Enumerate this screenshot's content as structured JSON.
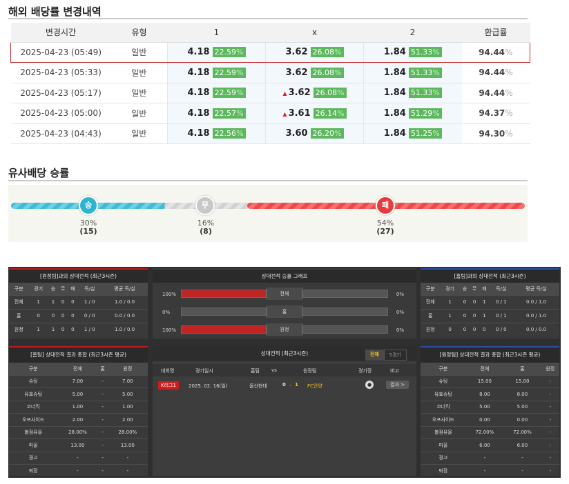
{
  "odds_history": {
    "title": "해외 배당률 변경내역",
    "headers": [
      "변경시간",
      "유형",
      "1",
      "x",
      "2",
      "환급률"
    ],
    "rows": [
      {
        "time": "2025-04-23 (05:49)",
        "type": "일반",
        "o1": "4.18",
        "p1": "22.59",
        "ox": "3.62",
        "px": "26.08",
        "ox_arrow": "",
        "o2": "1.84",
        "p2": "51.33",
        "refund": "94.44"
      },
      {
        "time": "2025-04-23 (05:33)",
        "type": "일반",
        "o1": "4.18",
        "p1": "22.59",
        "ox": "3.62",
        "px": "26.08",
        "ox_arrow": "",
        "o2": "1.84",
        "p2": "51.33",
        "refund": "94.44"
      },
      {
        "time": "2025-04-23 (05:17)",
        "type": "일반",
        "o1": "4.18",
        "p1": "22.59",
        "ox": "3.62",
        "px": "26.08",
        "ox_arrow": "▲",
        "o2": "1.84",
        "p2": "51.33",
        "refund": "94.44"
      },
      {
        "time": "2025-04-23 (05:00)",
        "type": "일반",
        "o1": "4.18",
        "p1": "22.57",
        "ox": "3.61",
        "px": "26.14",
        "ox_arrow": "▲",
        "o2": "1.84",
        "p2": "51.29",
        "refund": "94.37"
      },
      {
        "time": "2025-04-23 (04:43)",
        "type": "일반",
        "o1": "4.18",
        "p1": "22.56",
        "ox": "3.60",
        "px": "26.20",
        "ox_arrow": "",
        "o2": "1.84",
        "p2": "51.25",
        "refund": "94.30"
      }
    ],
    "unit": "%"
  },
  "similar_odds": {
    "title": "유사배당 승률",
    "win": {
      "label": "승",
      "pct": "30%",
      "count": "(15)",
      "value": 30,
      "color": "#3fbcd6"
    },
    "draw": {
      "label": "무",
      "pct": "16%",
      "count": "(8)",
      "value": 16,
      "color": "#cfcfcf"
    },
    "lose": {
      "label": "패",
      "pct": "54%",
      "count": "(27)",
      "value": 54,
      "color": "#f05050"
    }
  },
  "away_record": {
    "title": "[원정팀]과의 상대전적 (최근3시즌)",
    "headers": [
      "구분",
      "경기",
      "승",
      "무",
      "패",
      "득/실",
      "평균 득/실"
    ],
    "rows": [
      [
        "전체",
        "1",
        "1",
        "0",
        "0",
        "1 / 0",
        "1.0 / 0.0"
      ],
      [
        "홈",
        "0",
        "0",
        "0",
        "0",
        "0 / 0",
        "0.0 / 0.0"
      ],
      [
        "원정",
        "1",
        "1",
        "0",
        "0",
        "1 / 0",
        "1.0 / 0.0"
      ]
    ]
  },
  "record_graph": {
    "title": "상대전적 승률 그래프",
    "rows": [
      {
        "left": "100%",
        "label": "전체",
        "right": "0%",
        "value": 100
      },
      {
        "left": "0%",
        "label": "홈",
        "right": "0%",
        "value": 0
      },
      {
        "left": "100%",
        "label": "원정",
        "right": "0%",
        "value": 100
      }
    ]
  },
  "home_record": {
    "title": "[홈팀]과의 상대전적 (최근3시즌)",
    "headers": [
      "구분",
      "경기",
      "승",
      "무",
      "패",
      "득/실",
      "평균 득/실"
    ],
    "rows": [
      [
        "전체",
        "1",
        "0",
        "0",
        "1",
        "0 / 1",
        "0.0 / 1.0"
      ],
      [
        "홈",
        "1",
        "0",
        "0",
        "1",
        "0 / 1",
        "0.0 / 1.0"
      ],
      [
        "원정",
        "0",
        "0",
        "0",
        "0",
        "0 / 0",
        "0.0 / 0.0"
      ]
    ]
  },
  "home_stats": {
    "title": "[홈팀] 상대전적 결과 종합 (최근3시즌 평균)",
    "headers": [
      "구분",
      "전체",
      "홈",
      "원정"
    ],
    "rows": [
      [
        "슈팅",
        "7.00",
        "-",
        "7.00"
      ],
      [
        "유효슈팅",
        "5.00",
        "-",
        "5.00"
      ],
      [
        "코너킥",
        "1.00",
        "-",
        "1.00"
      ],
      [
        "오프사이드",
        "2.00",
        "-",
        "2.00"
      ],
      [
        "볼점유율",
        "28.00%",
        "-",
        "28.00%"
      ],
      [
        "파울",
        "13.00",
        "-",
        "13.00"
      ],
      [
        "경고",
        "-",
        "-",
        "-"
      ],
      [
        "퇴장",
        "-",
        "-",
        "-"
      ]
    ]
  },
  "match_list": {
    "title": "상대전적 (최근3시즌)",
    "tab_all": "전체",
    "tab_five": "5경기",
    "headers": [
      "대회명",
      "경기일시",
      "홈팀",
      "vs",
      "원정팀",
      "경기장",
      "비고"
    ],
    "matches": [
      {
        "league": "K리그1",
        "date": "2025. 02. 16(일)",
        "home": "울산현대",
        "score_home": "0",
        "dash": "-",
        "score_away": "1",
        "away": "FC안양",
        "button": "결과 >"
      }
    ]
  },
  "away_stats": {
    "title": "[원정팀] 상대전적 결과 종합 (최근3시즌 평균)",
    "headers": [
      "구분",
      "전체",
      "홈",
      "원정"
    ],
    "rows": [
      [
        "슈팅",
        "15.00",
        "15.00",
        "-"
      ],
      [
        "유효슈팅",
        "8.00",
        "8.00",
        "-"
      ],
      [
        "코너킥",
        "5.00",
        "5.00",
        "-"
      ],
      [
        "오프사이드",
        "0.00",
        "0.00",
        "-"
      ],
      [
        "볼점유율",
        "72.00%",
        "72.00%",
        "-"
      ],
      [
        "파울",
        "6.00",
        "6.00",
        "-"
      ],
      [
        "경고",
        "-",
        "-",
        "-"
      ],
      [
        "퇴장",
        "-",
        "-",
        "-"
      ]
    ]
  }
}
